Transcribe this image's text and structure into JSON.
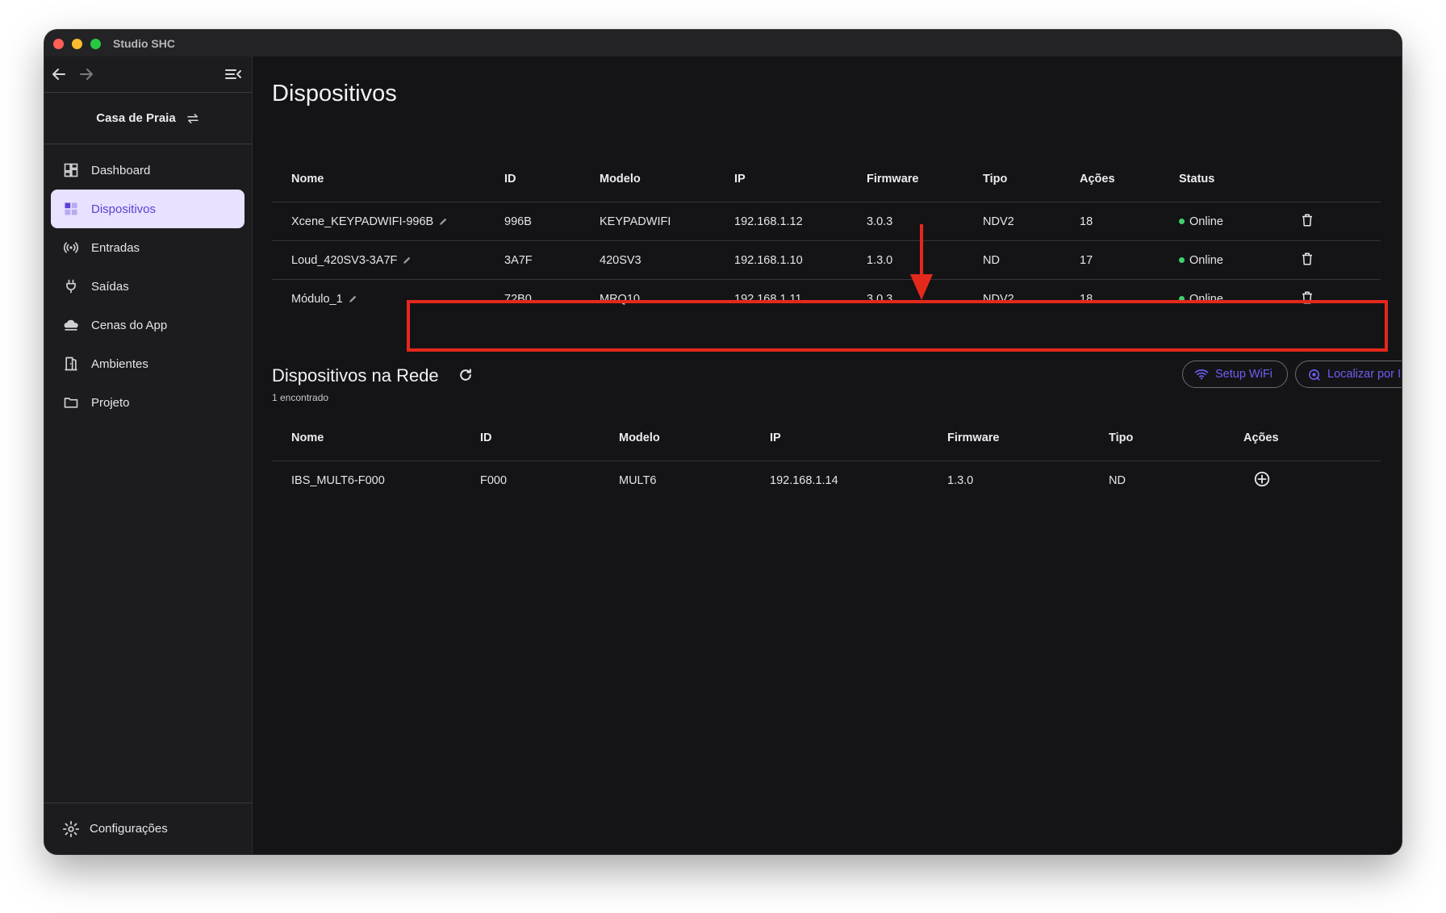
{
  "window": {
    "title": "Studio SHC"
  },
  "sidebar": {
    "project": "Casa de Praia",
    "items": [
      {
        "label": "Dashboard",
        "icon": "dashboard-icon"
      },
      {
        "label": "Dispositivos",
        "icon": "devices-icon",
        "active": true
      },
      {
        "label": "Entradas",
        "icon": "broadcast-icon"
      },
      {
        "label": "Saídas",
        "icon": "plug-icon"
      },
      {
        "label": "Cenas do App",
        "icon": "cloud-icon"
      },
      {
        "label": "Ambientes",
        "icon": "door-icon"
      },
      {
        "label": "Projeto",
        "icon": "folder-icon"
      }
    ],
    "settings": "Configurações"
  },
  "main": {
    "title": "Dispositivos",
    "devices": {
      "headers": [
        "Nome",
        "ID",
        "Modelo",
        "IP",
        "Firmware",
        "Tipo",
        "Ações",
        "Status"
      ],
      "rows": [
        {
          "name": "Xcene_KEYPADWIFI-996B",
          "id": "996B",
          "model": "KEYPADWIFI",
          "ip": "192.168.1.12",
          "firmware": "3.0.3",
          "type": "NDV2",
          "actions": "18",
          "status": "Online"
        },
        {
          "name": "Loud_420SV3-3A7F",
          "id": "3A7F",
          "model": "420SV3",
          "ip": "192.168.1.10",
          "firmware": "1.3.0",
          "type": "ND",
          "actions": "17",
          "status": "Online"
        },
        {
          "name": "Módulo_1",
          "id": "72B0",
          "model": "MRQ10",
          "ip": "192.168.1.11",
          "firmware": "3.0.3",
          "type": "NDV2",
          "actions": "18",
          "status": "Online"
        }
      ]
    },
    "network": {
      "title": "Dispositivos na Rede",
      "subtitle": "1 encontrado",
      "setup_wifi": "Setup WiFi",
      "find_by_ip": "Localizar por IP",
      "headers": [
        "Nome",
        "ID",
        "Modelo",
        "IP",
        "Firmware",
        "Tipo",
        "Ações"
      ],
      "rows": [
        {
          "name": "IBS_MULT6-F000",
          "id": "F000",
          "model": "MULT6",
          "ip": "192.168.1.14",
          "firmware": "1.3.0",
          "type": "ND"
        }
      ]
    }
  },
  "colors": {
    "accent": "#5b41d6",
    "online": "#3fd36b",
    "annotation": "#e5281c"
  }
}
